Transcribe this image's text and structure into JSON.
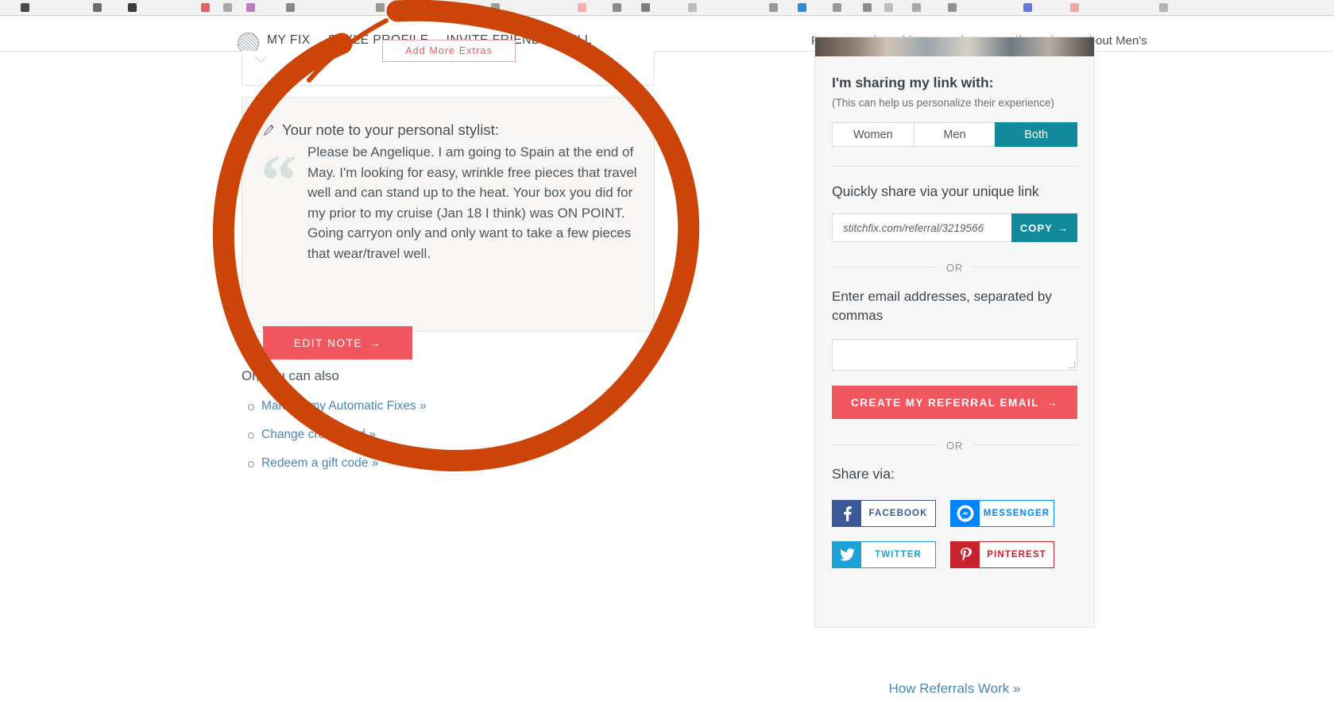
{
  "browser": {
    "tab_strip_visible": true
  },
  "header": {
    "logo_icon": "stitchfix-logo-icon",
    "nav_left": [
      {
        "label": "MY FIX"
      },
      {
        "label": "STYLE PROFILE"
      },
      {
        "label": "INVITE FRIENDS"
      },
      {
        "label": "JILL"
      }
    ],
    "nav_right": [
      {
        "label": "FAQ"
      },
      {
        "label": "Style Guide"
      },
      {
        "label": "Reviews"
      },
      {
        "label": "Gift Cards"
      },
      {
        "label": "About Men's"
      }
    ]
  },
  "main": {
    "top_card": {
      "add_extras_label": "Add More Extras"
    },
    "note_card": {
      "heading": "Your note to your personal stylist:",
      "pencil_icon": "pencil-icon",
      "quote_glyph": "“",
      "body": "Please be Angelique.  I am going to Spain at the end of May. I'm looking for easy, wrinkle free pieces that travel well and can stand up to the heat. Your box you did for my prior to my cruise (Jan 18 I think) was ON POINT. Going carryon only and only want to take a few pieces that wear/travel well.",
      "edit_button_label": "EDIT NOTE",
      "edit_button_arrow": "→",
      "edit_button_color": "#f0575e"
    },
    "also": {
      "title": "Or, you can also",
      "links": [
        {
          "label": "Manage my Automatic Fixes »"
        },
        {
          "label": "Change credit card »"
        },
        {
          "label": "Redeem a gift code  »"
        }
      ]
    }
  },
  "sidebar": {
    "sharing_with": {
      "heading": "I'm sharing my link with:",
      "subtext": "(This can help us personalize their experience)",
      "options": [
        {
          "label": "Women",
          "selected": false
        },
        {
          "label": "Men",
          "selected": false
        },
        {
          "label": "Both",
          "selected": true
        }
      ],
      "selected_color": "#118a9b"
    },
    "quick_share": {
      "heading": "Quickly share via your unique link",
      "link_value": "stitchfix.com/referral/3219566",
      "copy_label": "COPY",
      "copy_arrow": "→"
    },
    "divider_or": "OR",
    "email_section": {
      "label": "Enter email addresses, separated by commas",
      "input_value": "",
      "input_placeholder": "",
      "create_button_label": "CREATE MY REFERRAL EMAIL",
      "create_button_arrow": "→",
      "create_button_color": "#f0575e"
    },
    "share_via": {
      "label": "Share via:",
      "buttons": [
        {
          "label": "FACEBOOK",
          "icon": "facebook-icon",
          "color": "#3b5998"
        },
        {
          "label": "MESSENGER",
          "icon": "messenger-icon",
          "color": "#0084ff"
        },
        {
          "label": "TWITTER",
          "icon": "twitter-icon",
          "color": "#1da1d8"
        },
        {
          "label": "PINTEREST",
          "icon": "pinterest-icon",
          "color": "#c8232c"
        }
      ]
    }
  },
  "footer": {
    "how_referrals_label": "How Referrals Work »"
  },
  "annotation": {
    "type": "hand-drawn-circle",
    "color": "#cc4408"
  }
}
